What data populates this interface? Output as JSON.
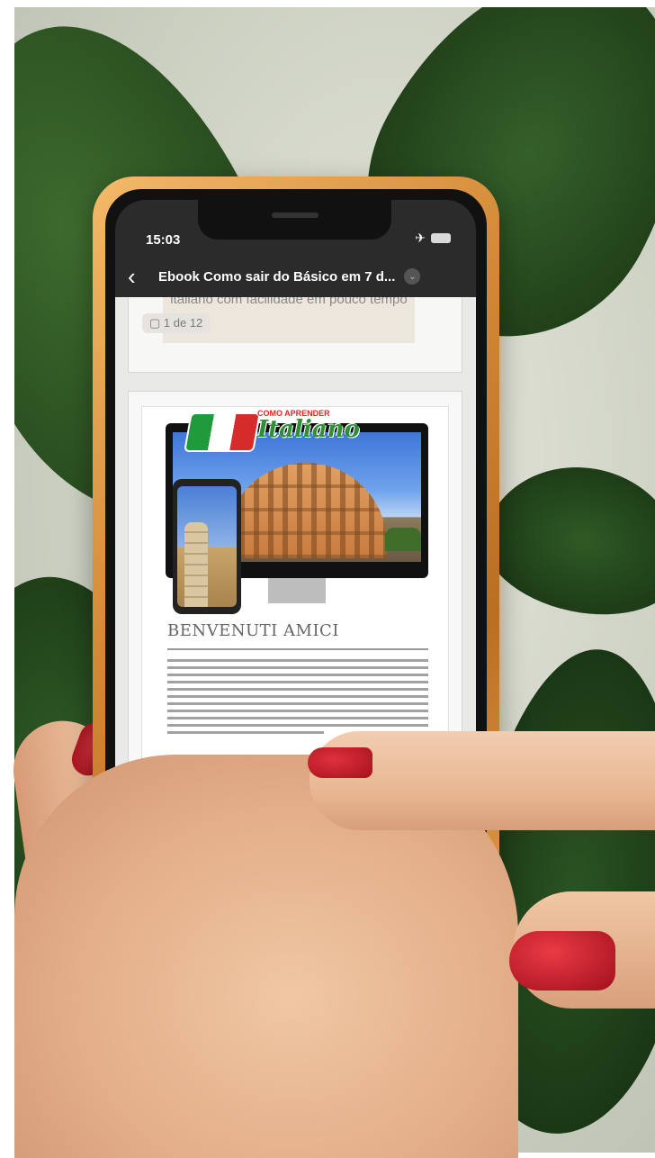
{
  "status_bar": {
    "time": "15:03",
    "airplane_icon": "airplane-icon",
    "battery_icon": "battery-icon"
  },
  "nav": {
    "back_icon": "chevron-left-icon",
    "title": "Ebook Como sair do Básico em 7 d...",
    "more_icon": "chevron-down-icon"
  },
  "document": {
    "prev_page_text": "italiano com facilidade em pouco tempo",
    "page_counter": "1 de 12",
    "logo_small": "COMO APRENDER",
    "logo_main": "Italiano",
    "heading": "BENVENUTI AMICI"
  },
  "toolbar": {
    "share_icon": "share-icon",
    "search_icon": "search-icon",
    "markup_icon": "markup-pen-icon",
    "signature_icon": "signature-icon"
  },
  "colors": {
    "phone_case": "#d38a36",
    "nail_polish": "#c21d2a",
    "ui_dark": "#2b2b2b"
  }
}
